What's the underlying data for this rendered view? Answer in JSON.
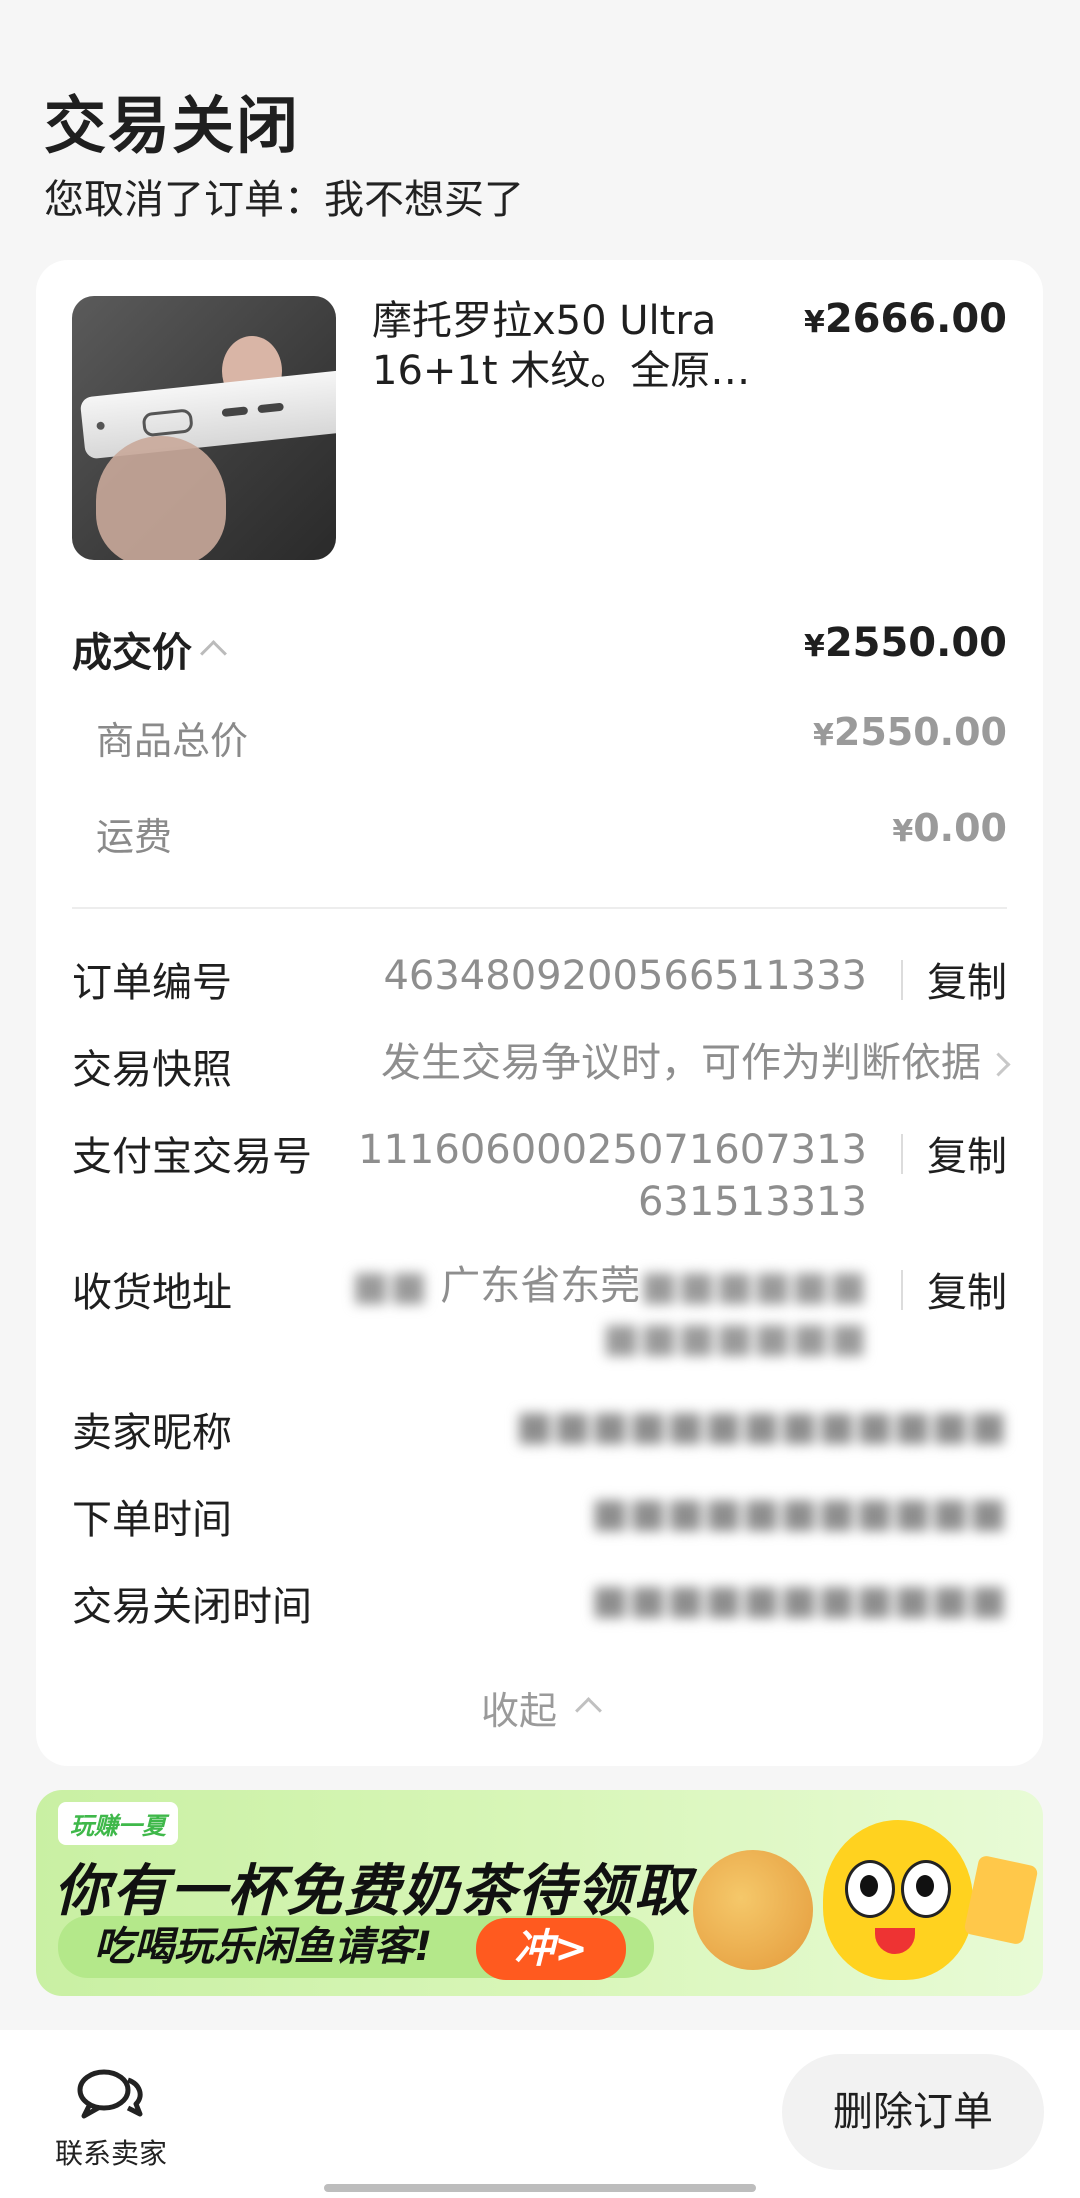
{
  "header": {
    "status_title": "交易关闭",
    "status_subtitle": "您取消了订单：我不想买了"
  },
  "product": {
    "title": "摩托罗拉x50 Ultra 16+1t 木纹。全原…",
    "price_symbol": "¥",
    "price": "2666.00"
  },
  "price_breakdown": {
    "deal_label": "成交价",
    "deal_value": "2550.00",
    "items": [
      {
        "label": "商品总价",
        "value": "2550.00"
      },
      {
        "label": "运费",
        "value": "0.00"
      }
    ]
  },
  "order_info": {
    "order_no_label": "订单编号",
    "order_no": "4634809200566511333",
    "copy_label": "复制",
    "snapshot_label": "交易快照",
    "snapshot_hint": "发生交易争议时，可作为判断依据",
    "alipay_label": "支付宝交易号",
    "alipay_line1": "11160600025071607313",
    "alipay_line2": "631513313",
    "address_label": "收货地址",
    "address_visible": "广东省东莞",
    "seller_label": "卖家昵称",
    "order_time_label": "下单时间",
    "close_time_label": "交易关闭时间",
    "collapse_label": "收起"
  },
  "banner": {
    "tag": "玩赚一夏",
    "headline": "你有一杯免费奶茶待领取",
    "sub": "吃喝玩乐闲鱼请客!",
    "cta": "冲>"
  },
  "bottom_bar": {
    "contact_label": "联系卖家",
    "delete_label": "删除订单"
  }
}
